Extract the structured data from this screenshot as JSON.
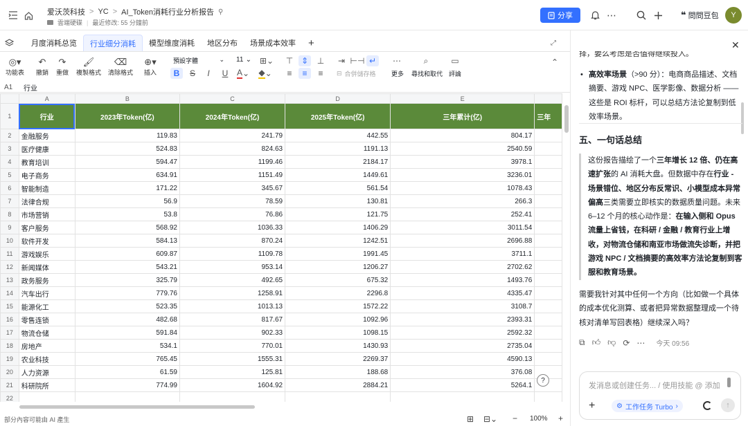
{
  "breadcrumb": {
    "org": "爱沃茨科技",
    "space": "YC",
    "doc": "AI_Token消耗行业分析报告"
  },
  "meta": {
    "location": "雲端硬碟",
    "modified": "最近修改: 55 分鐘前"
  },
  "header": {
    "share": "分享",
    "user_label": "問問豆包",
    "avatar_letter": "Y"
  },
  "sheet_tabs": [
    "月度消耗总览",
    "行业细分消耗",
    "模型维度消耗",
    "地区分布",
    "场景成本效率"
  ],
  "active_tab": "行业细分消耗",
  "toolbar": {
    "feature_table": "功能表",
    "undo": "撤銷",
    "redo": "重做",
    "copy_format": "複製格式",
    "clear_format": "清除格式",
    "insert": "插入",
    "font": "預設字體",
    "font_size": "11",
    "merge_cells": "合併儲存格",
    "more": "更多",
    "find_replace": "尋找和取代",
    "comment": "評論"
  },
  "formula_bar": {
    "cell": "A1",
    "value": "行业"
  },
  "columns": [
    "A",
    "B",
    "C",
    "D",
    "E"
  ],
  "table": {
    "headers": [
      "行业",
      "2023年Token(亿)",
      "2024年Token(亿)",
      "2025年Token(亿)",
      "三年累计(亿)",
      "三年"
    ],
    "rows": [
      [
        "金融服务",
        "119.83",
        "241.79",
        "442.55",
        "804.17"
      ],
      [
        "医疗健康",
        "524.83",
        "824.63",
        "1191.13",
        "2540.59"
      ],
      [
        "教育培训",
        "594.47",
        "1199.46",
        "2184.17",
        "3978.1"
      ],
      [
        "电子商务",
        "634.91",
        "1151.49",
        "1449.61",
        "3236.01"
      ],
      [
        "智能制造",
        "171.22",
        "345.67",
        "561.54",
        "1078.43"
      ],
      [
        "法律合规",
        "56.9",
        "78.59",
        "130.81",
        "266.3"
      ],
      [
        "市场营销",
        "53.8",
        "76.86",
        "121.75",
        "252.41"
      ],
      [
        "客户服务",
        "568.92",
        "1036.33",
        "1406.29",
        "3011.54"
      ],
      [
        "软件开发",
        "584.13",
        "870.24",
        "1242.51",
        "2696.88"
      ],
      [
        "游戏娱乐",
        "609.87",
        "1109.78",
        "1991.45",
        "3711.1"
      ],
      [
        "新闻媒体",
        "543.21",
        "953.14",
        "1206.27",
        "2702.62"
      ],
      [
        "政务服务",
        "325.79",
        "492.65",
        "675.32",
        "1493.76"
      ],
      [
        "汽车出行",
        "779.76",
        "1258.91",
        "2296.8",
        "4335.47"
      ],
      [
        "能源化工",
        "523.35",
        "1013.13",
        "1572.22",
        "3108.7"
      ],
      [
        "零售连锁",
        "482.68",
        "817.67",
        "1092.96",
        "2393.31"
      ],
      [
        "物流仓储",
        "591.84",
        "902.33",
        "1098.15",
        "2592.32"
      ],
      [
        "房地产",
        "534.1",
        "770.01",
        "1430.93",
        "2735.04"
      ],
      [
        "农业科技",
        "765.45",
        "1555.31",
        "2269.37",
        "4590.13"
      ],
      [
        "人力资源",
        "61.59",
        "125.81",
        "188.68",
        "376.08"
      ],
      [
        "科研院所",
        "774.99",
        "1604.92",
        "2884.21",
        "5264.1"
      ]
    ]
  },
  "status": {
    "ai_note": "部分內容可能由 AI 產生",
    "zoom": "100%"
  },
  "panel": {
    "top_cut": "择，要么考虑是否值得继续投入。",
    "bullet_bold": "高效率场景",
    "bullet_rest": "（>90 分）：电商商品描述、文档摘要、游戏 NPC、医学影像、数据分析 —— 这些是 ROI 标杆，可以总结方法论复制到低效率场景。",
    "section_title": "五、一句话总结",
    "q1": "这份报告描绘了一个",
    "q2": "三年增长 12 倍、仍在高速扩张",
    "q3": "的 AI 消耗大盘。但数据中存在",
    "q4": "行业 - 场景错位、地区分布反常识、小模型成本异常偏高",
    "q5": "三类需要立即核实的数据质量问题。未来 6–12 个月的核心动作是：",
    "q6": "在输入侧和 Opus 流量上省钱，在科研 / 金融 / 教育行业上增收，对物流仓储和南亚市场做流失诊断，并把游戏 NPC / 文档摘要的高效率方法论复制到客服和教育场景。",
    "follow": "需要我针对其中任何一个方向（比如做一个具体的成本优化测算、或者把异常数据整理成一个待核对清单写回表格）继续深入吗？",
    "time": "今天 09:56",
    "input_placeholder": "发消息或创建任务... / 使用技能 @ 添加",
    "mode": "工作任务 Turbo"
  }
}
